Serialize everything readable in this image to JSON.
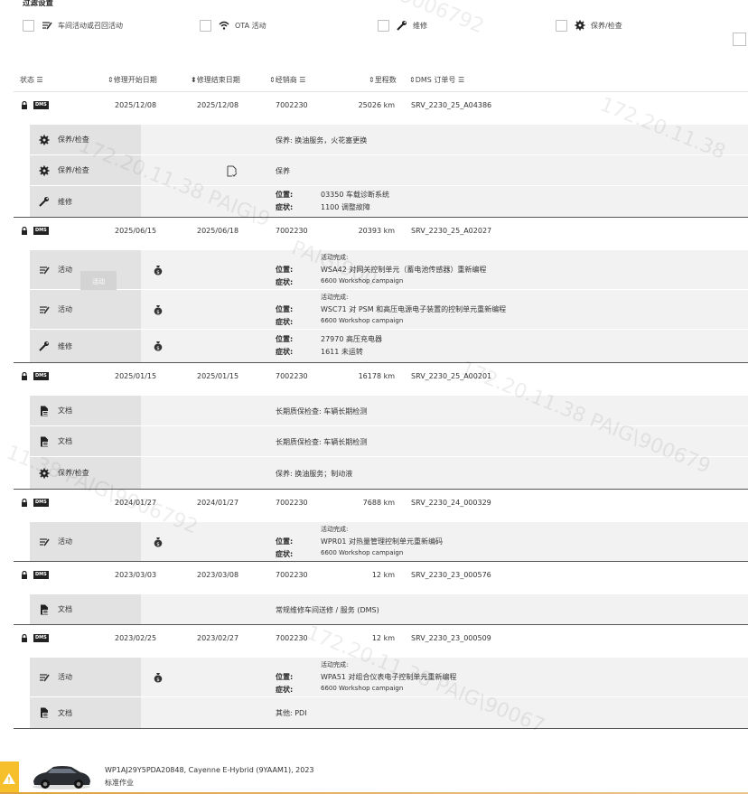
{
  "filter": {
    "title": "过滤设置",
    "items": [
      {
        "label": "车间活动或召回活动",
        "icon": "campaign-icon"
      },
      {
        "label": "OTA 活动",
        "icon": "wifi-icon"
      },
      {
        "label": "维修",
        "icon": "wrench-icon"
      },
      {
        "label": "保养/检查",
        "icon": "gear-icon"
      }
    ]
  },
  "columns": {
    "status": "状态",
    "start_date": "修理开始日期",
    "end_date": "修理结束日期",
    "dealer": "经销商",
    "mileage": "里程数",
    "dms_order": "DMS 订单号"
  },
  "badge_dms": "DMS",
  "tooltip": "活动",
  "labels": {
    "location": "位置:",
    "symptom": "症状:"
  },
  "groups": [
    {
      "start": "2025/12/08",
      "end": "2025/12/08",
      "dealer": "7002230",
      "mileage": "25026 km",
      "order": "SRV_2230_25_A04386",
      "items": [
        {
          "type": "保养/检查",
          "icon": "gear-icon",
          "desc": "保养: 换油服务，火花塞更换"
        },
        {
          "type": "保养/检查",
          "icon": "gear-icon",
          "desc": "保养",
          "doc_icon": true
        },
        {
          "type": "维修",
          "icon": "wrench-icon",
          "location": "03350 车载诊断系统",
          "symptom": "1100 调整故障"
        }
      ]
    },
    {
      "start": "2025/06/15",
      "end": "2025/06/18",
      "dealer": "7002230",
      "mileage": "20393 km",
      "order": "SRV_2230_25_A02027",
      "items": [
        {
          "type": "活动",
          "icon": "campaign-icon",
          "money": true,
          "tooltip": true,
          "loc_head": "活动完成:",
          "location": "WSA42 对网关控制单元（蓄电池传感器）重新编程",
          "symptom": "6600 Workshop campaign"
        },
        {
          "type": "活动",
          "icon": "campaign-icon",
          "money": true,
          "loc_head": "活动完成:",
          "location": "WSC71 对 PSM 和高压电源电子装置的控制单元重新编程",
          "symptom": "6600 Workshop campaign"
        },
        {
          "type": "维修",
          "icon": "wrench-icon",
          "money": true,
          "location": "27970 高压充电器",
          "symptom": "1611 未运转"
        }
      ]
    },
    {
      "start": "2025/01/15",
      "end": "2025/01/15",
      "dealer": "7002230",
      "mileage": "16178 km",
      "order": "SRV_2230_25_A00201",
      "items": [
        {
          "type": "文档",
          "icon": "document-icon",
          "desc": "长期质保检查: 车辆长期检测"
        },
        {
          "type": "文档",
          "icon": "document-icon",
          "desc": "长期质保检查: 车辆长期检测"
        },
        {
          "type": "保养/检查",
          "icon": "gear-icon",
          "desc": "保养: 换油服务；制动液"
        }
      ]
    },
    {
      "start": "2024/01/27",
      "end": "2024/01/27",
      "dealer": "7002230",
      "mileage": "7688 km",
      "order": "SRV_2230_24_000329",
      "items": [
        {
          "type": "活动",
          "icon": "campaign-icon",
          "money": true,
          "loc_head": "活动完成:",
          "location": "WPR01 对热量管理控制单元重新编码",
          "symptom": "6600 Workshop campaign"
        }
      ]
    },
    {
      "start": "2023/03/03",
      "end": "2023/03/08",
      "dealer": "7002230",
      "mileage": "12 km",
      "order": "SRV_2230_23_000576",
      "items": [
        {
          "type": "文档",
          "icon": "document-icon",
          "desc": "常规维修车间送修 / 服务 (DMS)"
        }
      ]
    },
    {
      "start": "2023/02/25",
      "end": "2023/02/27",
      "dealer": "7002230",
      "mileage": "12 km",
      "order": "SRV_2230_23_000509",
      "items": [
        {
          "type": "活动",
          "icon": "campaign-icon",
          "money": true,
          "loc_head": "活动完成:",
          "location": "WPA51 对组合仪表电子控制单元重新编程",
          "symptom": "6600 Workshop campaign"
        },
        {
          "type": "文档",
          "icon": "document-icon",
          "desc": "其他: PDI"
        }
      ]
    }
  ],
  "footer": {
    "vehicle": "WP1AJ29Y5PDA20848, Cayenne E-Hybrid (9YAAM1), 2023",
    "job": "标准作业"
  },
  "watermark": "172.20.11.38 PAIG\\9006792"
}
